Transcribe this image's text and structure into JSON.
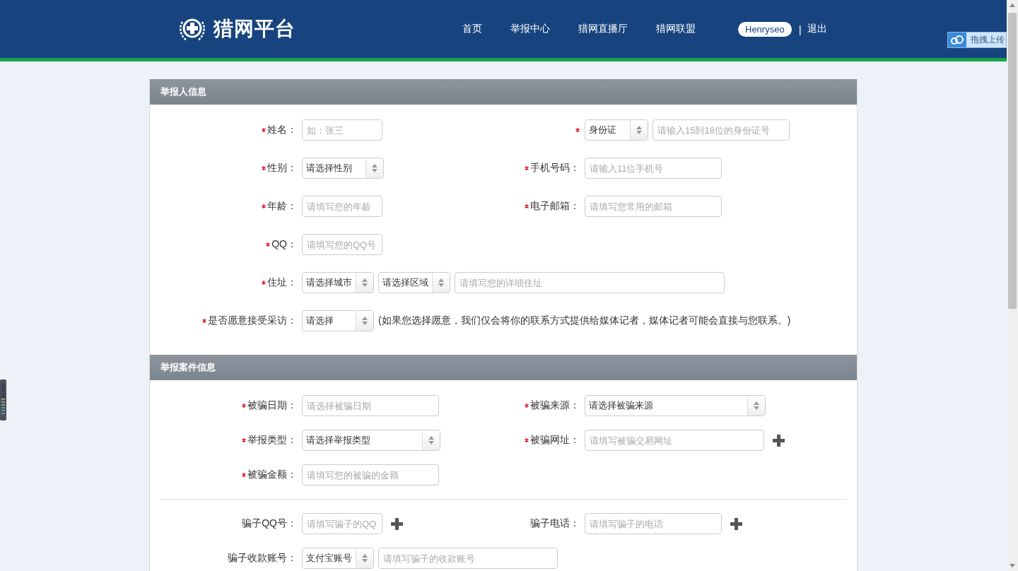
{
  "header": {
    "logo_text": "猎网平台",
    "nav": [
      {
        "label": "首页"
      },
      {
        "label": "举报中心"
      },
      {
        "label": "猎网直播厅"
      },
      {
        "label": "猎网联盟"
      }
    ],
    "user": "Henryseo",
    "separator": "|",
    "logout": "退出"
  },
  "upload_widget": {
    "label": "拖拽上传"
  },
  "sections": [
    {
      "title": "举报人信息",
      "rows": [
        {
          "cells": [
            {
              "label": "姓名：",
              "required": true,
              "controls": [
                {
                  "kind": "input",
                  "placeholder": "如：张三"
                }
              ]
            },
            {
              "required": true,
              "controls": [
                {
                  "kind": "select",
                  "value": "身份证"
                },
                {
                  "kind": "input",
                  "placeholder": "请输入15到18位的身份证号"
                }
              ]
            }
          ]
        },
        {
          "cells": [
            {
              "label": "性别：",
              "required": true,
              "controls": [
                {
                  "kind": "select",
                  "value": "请选择性别"
                }
              ]
            },
            {
              "label": "手机号码：",
              "required": true,
              "controls": [
                {
                  "kind": "input",
                  "placeholder": "请输入11位手机号"
                }
              ]
            }
          ]
        },
        {
          "cells": [
            {
              "label": "年龄：",
              "required": true,
              "controls": [
                {
                  "kind": "input",
                  "placeholder": "请填写您的年龄"
                }
              ]
            },
            {
              "label": "电子邮箱：",
              "required": true,
              "controls": [
                {
                  "kind": "input",
                  "placeholder": "请填写您常用的邮箱"
                }
              ]
            }
          ]
        },
        {
          "cells": [
            {
              "label": "QQ：",
              "required": true,
              "controls": [
                {
                  "kind": "input",
                  "placeholder": "请填写您的QQ号"
                }
              ]
            }
          ]
        },
        {
          "cells": [
            {
              "label": "住址：",
              "required": true,
              "controls": [
                {
                  "kind": "select",
                  "value": "请选择城市"
                },
                {
                  "kind": "select",
                  "value": "请选择区域"
                },
                {
                  "kind": "input",
                  "placeholder": "请填写您的详细住址"
                }
              ]
            }
          ]
        },
        {
          "cells": [
            {
              "label": "是否愿意接受采访：",
              "required": true,
              "controls": [
                {
                  "kind": "select",
                  "value": "请选择"
                },
                {
                  "kind": "note",
                  "text": "(如果您选择愿意，我们仅会将你的联系方式提供给媒体记者，媒体记者可能会直接与您联系。)"
                }
              ]
            }
          ]
        }
      ]
    },
    {
      "title": "举报案件信息",
      "rows": [
        {
          "cells": [
            {
              "label": "被骗日期：",
              "required": true,
              "controls": [
                {
                  "kind": "input",
                  "placeholder": "请选择被骗日期"
                }
              ]
            },
            {
              "label": "被骗来源：",
              "required": true,
              "controls": [
                {
                  "kind": "select",
                  "value": "请选择被骗来源"
                }
              ]
            }
          ]
        },
        {
          "cells": [
            {
              "label": "举报类型：",
              "required": true,
              "controls": [
                {
                  "kind": "select",
                  "value": "请选择举报类型"
                }
              ]
            },
            {
              "label": "被骗网址：",
              "required": true,
              "controls": [
                {
                  "kind": "input",
                  "placeholder": "请填写被骗交易网址"
                },
                {
                  "kind": "add"
                }
              ]
            }
          ]
        },
        {
          "cells": [
            {
              "label": "被骗金额：",
              "required": true,
              "controls": [
                {
                  "kind": "input",
                  "placeholder": "请填写您的被骗的金额"
                }
              ]
            }
          ]
        },
        {
          "group_start": true,
          "cells": [
            {
              "label": "骗子QQ号：",
              "required": false,
              "controls": [
                {
                  "kind": "input",
                  "placeholder": "请填写骗子的QQ"
                },
                {
                  "kind": "add"
                }
              ]
            },
            {
              "label": "骗子电话：",
              "required": false,
              "controls": [
                {
                  "kind": "input",
                  "placeholder": "请填写骗子的电话"
                },
                {
                  "kind": "add"
                }
              ]
            }
          ]
        },
        {
          "cells": [
            {
              "label": "骗子收款账号：",
              "required": false,
              "controls": [
                {
                  "kind": "select",
                  "value": "支付宝账号"
                },
                {
                  "kind": "input",
                  "placeholder": "请填写骗子的收款账号"
                }
              ]
            }
          ]
        }
      ]
    }
  ]
}
